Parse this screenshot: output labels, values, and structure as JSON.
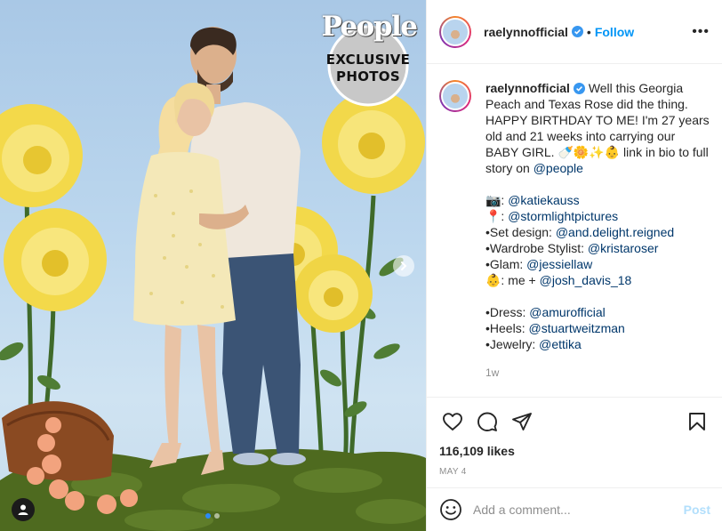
{
  "post": {
    "username": "raelynnofficial",
    "header_separator": "•",
    "follow_label": "Follow",
    "more_label": "•••",
    "publisher_badge": {
      "name": "People",
      "tag_line1": "EXCLUSIVE",
      "tag_line2": "PHOTOS"
    },
    "carousel": {
      "count": 2,
      "active_index": 0
    }
  },
  "caption": {
    "username": "raelynnofficial",
    "text_main": "Well this Georgia Peach and Texas Rose did the thing. HAPPY BIRTHDAY TO ME! I'm 27 years old and 21 weeks into carrying our BABY GIRL. 🍼🌼✨👶 link in bio to full story on ",
    "text_main_mention": "@people",
    "credits": [
      {
        "prefix": "📷: ",
        "mention": "@katiekauss"
      },
      {
        "prefix": "📍: ",
        "mention": "@stormlightpictures"
      },
      {
        "prefix": "•Set design: ",
        "mention": "@and.delight.reigned"
      },
      {
        "prefix": "•Wardrobe Stylist: ",
        "mention": "@kristaroser"
      },
      {
        "prefix": "•Glam: ",
        "mention": "@jessiellaw"
      },
      {
        "prefix": "👶: me + ",
        "mention": "@josh_davis_18"
      }
    ],
    "outfit": [
      {
        "prefix": "•Dress: ",
        "mention": "@amurofficial"
      },
      {
        "prefix": "•Heels: ",
        "mention": "@stuartweitzman"
      },
      {
        "prefix": "•Jewelry: ",
        "mention": "@ettika"
      }
    ],
    "age": "1w"
  },
  "stats": {
    "likes": "116,109 likes",
    "date": "MAY 4"
  },
  "composer": {
    "placeholder": "Add a comment...",
    "post_label": "Post"
  },
  "colors": {
    "link_blue": "#0095f6",
    "mention_blue": "#00376b",
    "post_disabled": "#b2dffc",
    "verified_blue": "#3897f0"
  },
  "icons": {
    "like": "heart-icon",
    "comment": "comment-icon",
    "share": "paper-plane-icon",
    "save": "bookmark-icon",
    "emoji": "emoji-icon",
    "tags": "user-tag-icon",
    "next": "chevron-right-icon",
    "verified": "verified-badge-icon",
    "more": "more-options-icon"
  }
}
